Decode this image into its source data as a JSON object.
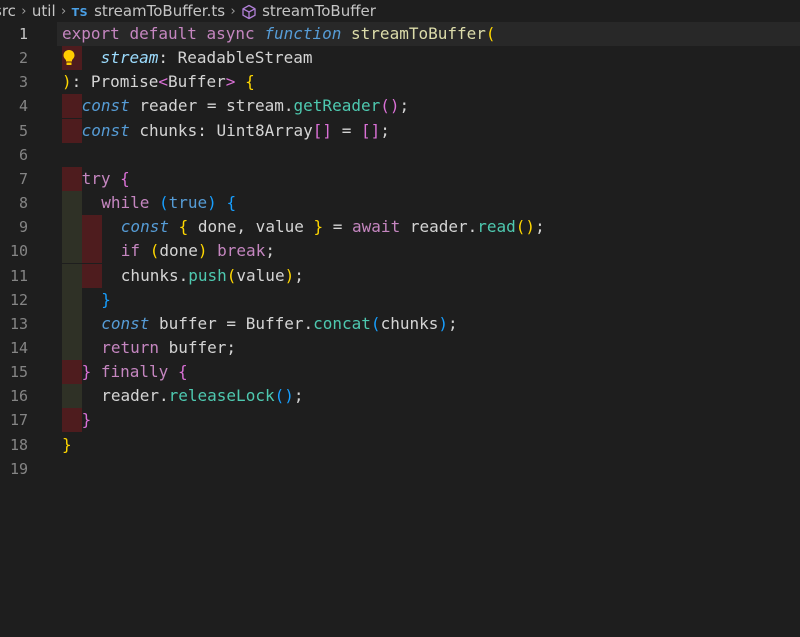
{
  "breadcrumb": {
    "folder1": "src",
    "folder2": "util",
    "file_badge": "TS",
    "file": "streamToBuffer.ts",
    "symbol": "streamToBuffer"
  },
  "editor": {
    "language": "typescript",
    "current_line": 1,
    "lines": [
      {
        "n": "1",
        "tokens": [
          [
            "k",
            "export"
          ],
          [
            "tx",
            " "
          ],
          [
            "k",
            "default"
          ],
          [
            "tx",
            " "
          ],
          [
            "k",
            "async"
          ],
          [
            "tx",
            " "
          ],
          [
            "fi",
            "function"
          ],
          [
            "tx",
            " "
          ],
          [
            "fn",
            "streamToBuffer"
          ],
          [
            "b1",
            "("
          ]
        ]
      },
      {
        "n": "2",
        "tokens": [
          [
            "pi",
            "stream"
          ],
          [
            "tx",
            ": ReadableStream"
          ]
        ]
      },
      {
        "n": "3",
        "tokens": [
          [
            "b1",
            ")"
          ],
          [
            "tx",
            ": Promise"
          ],
          [
            "b2",
            "<"
          ],
          [
            "tx",
            "Buffer"
          ],
          [
            "b2",
            ">"
          ],
          [
            "tx",
            " "
          ],
          [
            "b1",
            "{"
          ]
        ]
      },
      {
        "n": "4",
        "tokens": [
          [
            "fi",
            "const"
          ],
          [
            "tx",
            " reader = stream."
          ],
          [
            "fc",
            "getReader"
          ],
          [
            "b2",
            "()"
          ],
          [
            "tx",
            ";"
          ]
        ]
      },
      {
        "n": "5",
        "tokens": [
          [
            "fi",
            "const"
          ],
          [
            "tx",
            " chunks: Uint8Array"
          ],
          [
            "b2",
            "[]"
          ],
          [
            "tx",
            " = "
          ],
          [
            "b2",
            "[]"
          ],
          [
            "tx",
            ";"
          ]
        ]
      },
      {
        "n": "6",
        "tokens": []
      },
      {
        "n": "7",
        "tokens": [
          [
            "k",
            "try"
          ],
          [
            "tx",
            " "
          ],
          [
            "b2",
            "{"
          ]
        ]
      },
      {
        "n": "8",
        "tokens": [
          [
            "k",
            "while"
          ],
          [
            "tx",
            " "
          ],
          [
            "b3",
            "("
          ],
          [
            "kb",
            "true"
          ],
          [
            "b3",
            ")"
          ],
          [
            "tx",
            " "
          ],
          [
            "b3",
            "{"
          ]
        ]
      },
      {
        "n": "9",
        "tokens": [
          [
            "fi",
            "const"
          ],
          [
            "tx",
            " "
          ],
          [
            "b1",
            "{"
          ],
          [
            "tx",
            " done, value "
          ],
          [
            "b1",
            "}"
          ],
          [
            "tx",
            " = "
          ],
          [
            "k",
            "await"
          ],
          [
            "tx",
            " reader."
          ],
          [
            "fc",
            "read"
          ],
          [
            "b1",
            "()"
          ],
          [
            "tx",
            ";"
          ]
        ]
      },
      {
        "n": "10",
        "tokens": [
          [
            "k",
            "if"
          ],
          [
            "tx",
            " "
          ],
          [
            "b1",
            "("
          ],
          [
            "tx",
            "done"
          ],
          [
            "b1",
            ")"
          ],
          [
            "tx",
            " "
          ],
          [
            "k",
            "break"
          ],
          [
            "tx",
            ";"
          ]
        ]
      },
      {
        "n": "11",
        "tokens": [
          [
            "tx",
            "chunks."
          ],
          [
            "fc",
            "push"
          ],
          [
            "b1",
            "("
          ],
          [
            "tx",
            "value"
          ],
          [
            "b1",
            ")"
          ],
          [
            "tx",
            ";"
          ]
        ]
      },
      {
        "n": "12",
        "tokens": [
          [
            "b3",
            "}"
          ]
        ]
      },
      {
        "n": "13",
        "tokens": [
          [
            "fi",
            "const"
          ],
          [
            "tx",
            " buffer = Buffer."
          ],
          [
            "fc",
            "concat"
          ],
          [
            "b3",
            "("
          ],
          [
            "tx",
            "chunks"
          ],
          [
            "b3",
            ")"
          ],
          [
            "tx",
            ";"
          ]
        ]
      },
      {
        "n": "14",
        "tokens": [
          [
            "k",
            "return"
          ],
          [
            "tx",
            " buffer;"
          ]
        ]
      },
      {
        "n": "15",
        "tokens": [
          [
            "b2",
            "}"
          ],
          [
            "tx",
            " "
          ],
          [
            "k",
            "finally"
          ],
          [
            "tx",
            " "
          ],
          [
            "b2",
            "{"
          ]
        ]
      },
      {
        "n": "16",
        "tokens": [
          [
            "tx",
            "reader."
          ],
          [
            "fc",
            "releaseLock"
          ],
          [
            "b3",
            "()"
          ],
          [
            "tx",
            ";"
          ]
        ]
      },
      {
        "n": "17",
        "tokens": [
          [
            "b2",
            "}"
          ]
        ]
      },
      {
        "n": "18",
        "tokens": [
          [
            "b1",
            "}"
          ]
        ]
      },
      {
        "n": "19",
        "tokens": []
      }
    ]
  }
}
